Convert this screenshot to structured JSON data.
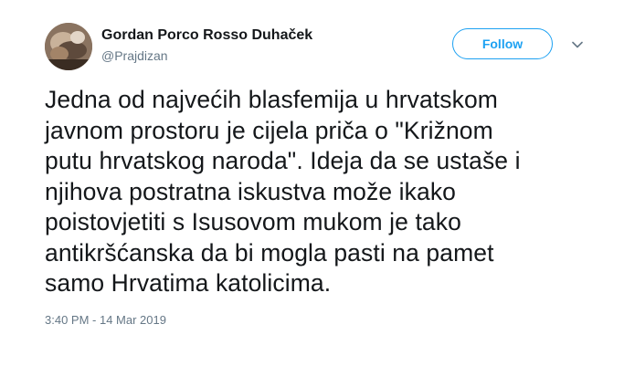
{
  "tweet": {
    "author": {
      "display_name": "Gordan Porco Rosso Duhaček",
      "handle": "@Prajdizan",
      "avatar": "profile-photo"
    },
    "follow_label": "Follow",
    "menu_icon": "chevron-down-icon",
    "text_lines": [
      "Jedna od najvećih blasfemija u hrvatskom",
      "javnom prostoru je cijela priča o \"Križnom",
      "putu hrvatskog naroda\". Ideja da se ustaše i",
      "njihova postratna iskustva može ikako",
      "poistovjetiti s Isusovom mukom je tako",
      "antikršćanska da bi mogla pasti na pamet",
      "samo Hrvatima katolicima."
    ],
    "timestamp": "3:40 PM - 14 Mar 2019"
  },
  "colors": {
    "accent": "#1da1f2",
    "text": "#14171a",
    "secondary_text": "#657786"
  }
}
